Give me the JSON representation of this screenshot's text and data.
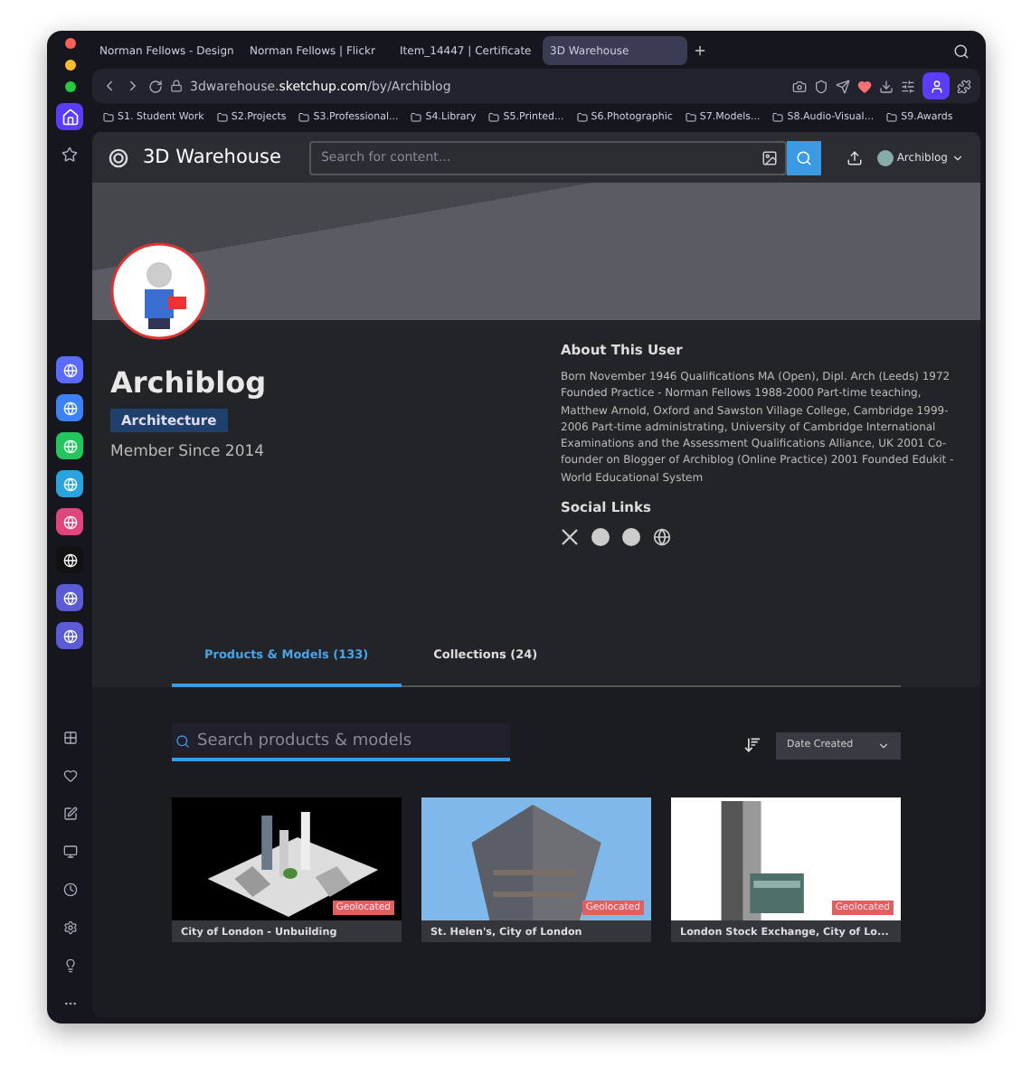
{
  "browser": {
    "tabs": [
      {
        "title": "Norman Fellows - Design",
        "selected": false
      },
      {
        "title": "Norman Fellows | Flickr",
        "selected": false
      },
      {
        "title": "Item_14447 | Certificate",
        "selected": false
      },
      {
        "title": "3D Warehouse",
        "selected": true
      }
    ],
    "address": {
      "host": "3dwarehouse.",
      "domain": "sketchup.com",
      "path": "/by/Archiblog"
    },
    "bookmarks": [
      "S1. Student Work",
      "S2.Projects",
      "S3.Professional...",
      "S4.Library",
      "S5.Printed...",
      "S6.Photographic",
      "S7.Models...",
      "S8.Audio-Visual...",
      "S9.Awards"
    ]
  },
  "site": {
    "logo": "3D Warehouse",
    "search_placeholder": "Search for content...",
    "user": "Archiblog"
  },
  "profile": {
    "name": "Archiblog",
    "tag": "Architecture",
    "member_since": "Member Since 2014",
    "about_title": "About This User",
    "about_text": "Born November 1946 Qualifications MA (Open), Dipl. Arch (Leeds) 1972 Founded Practice - Norman Fellows 1988-2000 Part-time teaching, Matthew Arnold, Oxford and Sawston Village College, Cambridge 1999-2006 Part-time administrating, University of Cambridge International Examinations and the Assessment Qualifications Alliance, UK 2001 Co-founder on Blogger of Archiblog (Online Practice) 2001 Founded Edukit - World Educational System",
    "social_title": "Social Links"
  },
  "content_tabs": [
    {
      "label": "Products & Models (133)",
      "selected": true
    },
    {
      "label": "Collections (24)",
      "selected": false
    }
  ],
  "model_search": {
    "placeholder": "Search products & models"
  },
  "sort": {
    "value": "Date Created"
  },
  "models": [
    {
      "title": "City of London - Unbuilding",
      "badge": "Geolocated",
      "kind": "city"
    },
    {
      "title": "St. Helen's, City of London",
      "badge": "Geolocated",
      "kind": "tower"
    },
    {
      "title": "London Stock Exchange, City of Lo...",
      "badge": "Geolocated",
      "kind": "white"
    }
  ]
}
